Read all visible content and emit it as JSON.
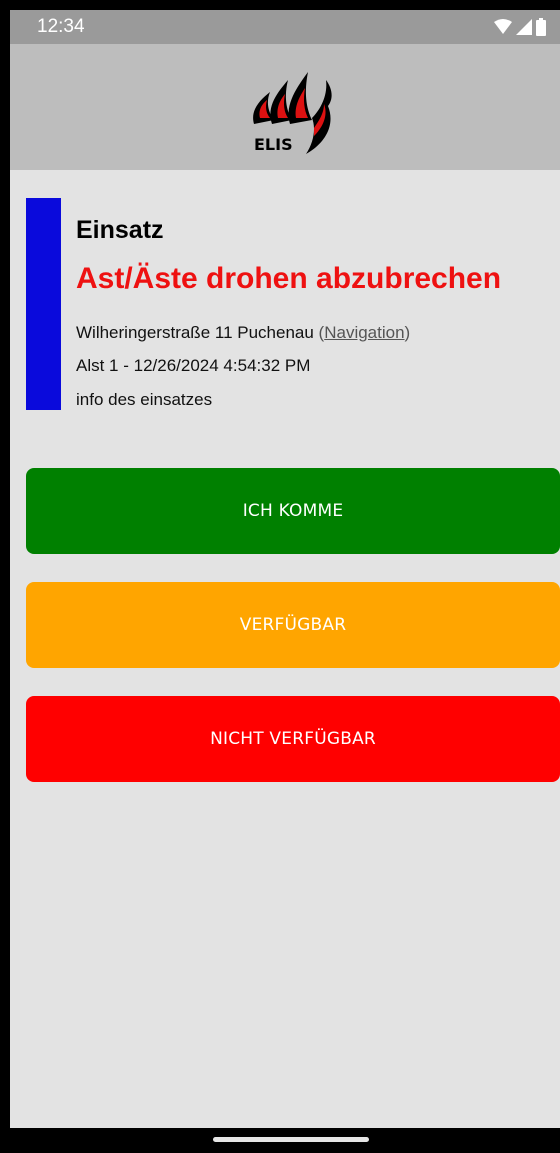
{
  "status_bar": {
    "time": "12:34",
    "icons": [
      "wifi-icon",
      "signal-icon",
      "battery-icon"
    ]
  },
  "header": {
    "logo_text": "ELIS"
  },
  "incident": {
    "heading": "Einsatz",
    "title": "Ast/Äste drohen abzubrechen",
    "address": "Wilheringerstraße 11 Puchenau",
    "paren_open": "(",
    "navigation_label": "Navigation",
    "paren_close": ")",
    "alarm_line": "Alst 1 - 12/26/2024 4:54:32 PM",
    "info": "info des einsatzes"
  },
  "actions": {
    "come_label": "ICH KOMME",
    "available_label": "VERFÜGBAR",
    "not_available_label": "NICHT VERFÜGBAR"
  },
  "colors": {
    "accent_bar": "#0a0adc",
    "title_red": "#ee1111",
    "come_green": "#008000",
    "available_orange": "#ffa500",
    "not_available_red": "#ff0000"
  }
}
